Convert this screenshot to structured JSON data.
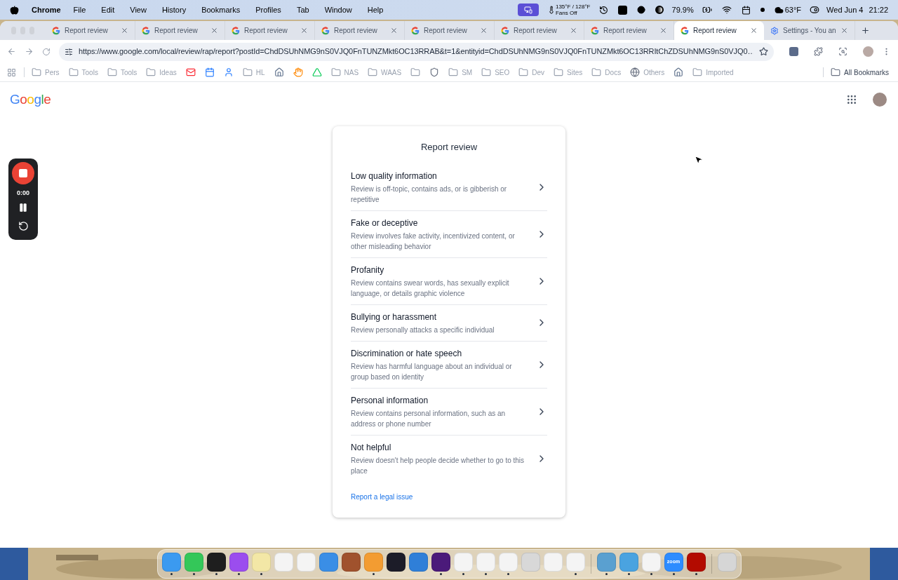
{
  "menu_bar": {
    "app": "Chrome",
    "items": [
      "File",
      "Edit",
      "View",
      "History",
      "Bookmarks",
      "Profiles",
      "Tab",
      "Window",
      "Help"
    ],
    "temperature": "135°F / 128°F",
    "fans": "Fans Off",
    "battery": "79.9%",
    "weather": "63°F",
    "date": "Wed Jun 4",
    "time": "21:22"
  },
  "tabs": [
    {
      "title": "Report review",
      "selected": false,
      "kind": "google"
    },
    {
      "title": "Report review",
      "selected": false,
      "kind": "google"
    },
    {
      "title": "Report review",
      "selected": false,
      "kind": "google"
    },
    {
      "title": "Report review",
      "selected": false,
      "kind": "google"
    },
    {
      "title": "Report review",
      "selected": false,
      "kind": "google"
    },
    {
      "title": "Report review",
      "selected": false,
      "kind": "google"
    },
    {
      "title": "Report review",
      "selected": false,
      "kind": "google"
    },
    {
      "title": "Report review",
      "selected": true,
      "kind": "google"
    },
    {
      "title": "Settings - You an",
      "selected": false,
      "kind": "settings"
    }
  ],
  "address_bar": {
    "url": "https://www.google.com/local/review/rap/report?postId=ChdDSUhNMG9nS0VJQ0FnTUNZMkt6OC13RRAB&t=1&entityid=ChdDSUhNMG9nS0VJQ0FnTUNZMkt6OC13RRItChZDSUhNMG9nS0VJQ0…",
    "starred": false
  },
  "bookmarks": [
    {
      "kind": "folder",
      "label": "Pers"
    },
    {
      "kind": "folder",
      "label": "Tools"
    },
    {
      "kind": "folder",
      "label": "Tools"
    },
    {
      "kind": "folder",
      "label": "Ideas"
    },
    {
      "kind": "mail"
    },
    {
      "kind": "calendar"
    },
    {
      "kind": "person"
    },
    {
      "kind": "folder",
      "label": "HL"
    },
    {
      "kind": "house"
    },
    {
      "kind": "hand"
    },
    {
      "kind": "drive"
    },
    {
      "kind": "folder",
      "label": "NAS"
    },
    {
      "kind": "folder",
      "label": "WAAS"
    },
    {
      "kind": "folder"
    },
    {
      "kind": "shield"
    },
    {
      "kind": "folder",
      "label": "SM"
    },
    {
      "kind": "folder",
      "label": "SEO"
    },
    {
      "kind": "folder",
      "label": "Dev"
    },
    {
      "kind": "folder",
      "label": "Sites"
    },
    {
      "kind": "folder",
      "label": "Docs"
    },
    {
      "kind": "globe",
      "label": "Others"
    },
    {
      "kind": "house"
    },
    {
      "kind": "folder",
      "label": "Imported"
    }
  ],
  "all_bookmarks": "All Bookmarks",
  "page": {
    "logo": "Google"
  },
  "recorder": {
    "time": "0:00"
  },
  "dialog": {
    "title": "Report review",
    "options": [
      {
        "title": "Low quality information",
        "description": "Review is off-topic, contains ads, or is gibberish or repetitive"
      },
      {
        "title": "Fake or deceptive",
        "description": "Review involves fake activity, incentivized content, or other misleading behavior"
      },
      {
        "title": "Profanity",
        "description": "Review contains swear words, has sexually explicit language, or details graphic violence"
      },
      {
        "title": "Bullying or harassment",
        "description": "Review personally attacks a specific individual"
      },
      {
        "title": "Discrimination or hate speech",
        "description": "Review has harmful language about an individual or group based on identity"
      },
      {
        "title": "Personal information",
        "description": "Review contains personal information, such as an address or phone number"
      },
      {
        "title": "Not helpful",
        "description": "Review doesn't help people decide whether to go to this place"
      }
    ],
    "link": "Report a legal issue"
  },
  "dock": [
    {
      "kind": "app",
      "color": "#3b9af0",
      "running": true
    },
    {
      "kind": "app",
      "color": "#34c759",
      "running": true
    },
    {
      "kind": "app",
      "color": "#1e1e1e",
      "running": true
    },
    {
      "kind": "app",
      "color": "#9b4dee",
      "running": true
    },
    {
      "kind": "app",
      "color": "#f3e7a6",
      "running": true
    },
    {
      "kind": "app",
      "color": "#f4f4f4",
      "running": false
    },
    {
      "kind": "app",
      "color": "#f4f4f4",
      "running": false
    },
    {
      "kind": "app",
      "color": "#3a8ee6",
      "running": false
    },
    {
      "kind": "app",
      "color": "#a0522d",
      "running": false
    },
    {
      "kind": "app",
      "color": "#f39c32",
      "running": true
    },
    {
      "kind": "app",
      "color": "#1c1c28",
      "running": false
    },
    {
      "kind": "app",
      "color": "#2f7fd8",
      "running": false
    },
    {
      "kind": "app",
      "color": "#4b1a7a",
      "running": true
    },
    {
      "kind": "app",
      "color": "#f4f4f4",
      "running": true
    },
    {
      "kind": "app",
      "color": "#f4f4f4",
      "running": true
    },
    {
      "kind": "app",
      "color": "#f4f4f4",
      "running": true
    },
    {
      "kind": "app",
      "color": "#d8d8d8",
      "running": false
    },
    {
      "kind": "app",
      "color": "#f4f4f4",
      "running": false
    },
    {
      "kind": "app",
      "color": "#f4f4f4",
      "running": true
    },
    {
      "kind": "separator"
    },
    {
      "kind": "app",
      "color": "#5aa0d0",
      "running": true
    },
    {
      "kind": "app",
      "color": "#4aa3e0",
      "running": true
    },
    {
      "kind": "app",
      "color": "#f4f4f4",
      "running": true
    },
    {
      "kind": "app",
      "color": "#2d8cff",
      "running": true,
      "label": "zoom"
    },
    {
      "kind": "app",
      "color": "#b30b00",
      "running": true
    },
    {
      "kind": "separator"
    },
    {
      "kind": "app",
      "color": "#d6d6d6",
      "running": false
    }
  ]
}
